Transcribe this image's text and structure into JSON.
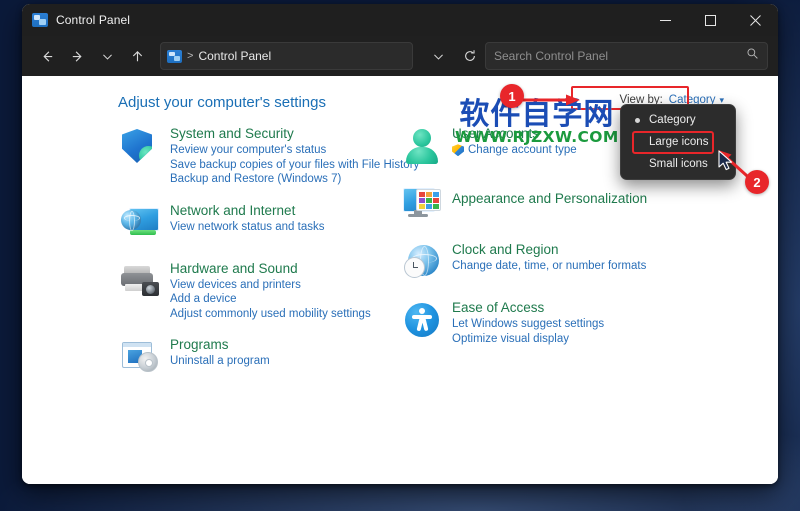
{
  "window": {
    "title": "Control Panel",
    "icon": "control-panel-icon",
    "controls": {
      "minimize": "Minimize",
      "maximize": "Maximize",
      "close": "Close"
    }
  },
  "navbar": {
    "back": "Back",
    "forward": "Forward",
    "recent": "Recent locations",
    "up": "Up",
    "refresh": "Refresh",
    "breadcrumb_separator": ">",
    "breadcrumb": "Control Panel",
    "search": {
      "placeholder": "Search Control Panel",
      "value": "",
      "icon": "search-icon"
    }
  },
  "content": {
    "page_title": "Adjust your computer's settings",
    "view_by": {
      "label": "View by:",
      "value": "Category",
      "caret": "▾",
      "options": [
        "Category",
        "Large icons",
        "Small icons"
      ],
      "selected": "Category",
      "highlighted": "Large icons"
    },
    "left_column": [
      {
        "icon": "shield-icon",
        "heading": "System and Security",
        "links": [
          "Review your computer's status",
          "Save backup copies of your files with File History",
          "Backup and Restore (Windows 7)"
        ]
      },
      {
        "icon": "network-globe-icon",
        "heading": "Network and Internet",
        "links": [
          "View network status and tasks"
        ]
      },
      {
        "icon": "printer-icon",
        "heading": "Hardware and Sound",
        "links": [
          "View devices and printers",
          "Add a device",
          "Adjust commonly used mobility settings"
        ]
      },
      {
        "icon": "programs-disc-icon",
        "heading": "Programs",
        "links": [
          "Uninstall a program"
        ]
      }
    ],
    "right_column": [
      {
        "icon": "user-account-icon",
        "heading": "User Accounts",
        "links": [
          "Change account type"
        ],
        "link_shield": true
      },
      {
        "icon": "appearance-monitor-icon",
        "heading": "Appearance and Personalization",
        "links": []
      },
      {
        "icon": "clock-globe-icon",
        "heading": "Clock and Region",
        "links": [
          "Change date, time, or number formats"
        ]
      },
      {
        "icon": "ease-of-access-icon",
        "heading": "Ease of Access",
        "links": [
          "Let Windows suggest settings",
          "Optimize visual display"
        ]
      }
    ]
  },
  "watermark": {
    "chinese": "软件自学网",
    "url": "WWW.RJZXW.COM"
  },
  "annotations": {
    "badge_1": "1",
    "badge_2": "2",
    "accent_red": "#e8262a"
  },
  "colors": {
    "titlebar": "#1f1f1f",
    "navbar": "#202020",
    "content_bg": "#ffffff",
    "heading_green": "#1f7a4d",
    "link_blue": "#2a6fb8",
    "page_title_blue": "#1a6fb5",
    "menu_bg": "#2c2c2c",
    "watermark_blue": "#1b4db5",
    "watermark_green": "#1b9a3e"
  }
}
